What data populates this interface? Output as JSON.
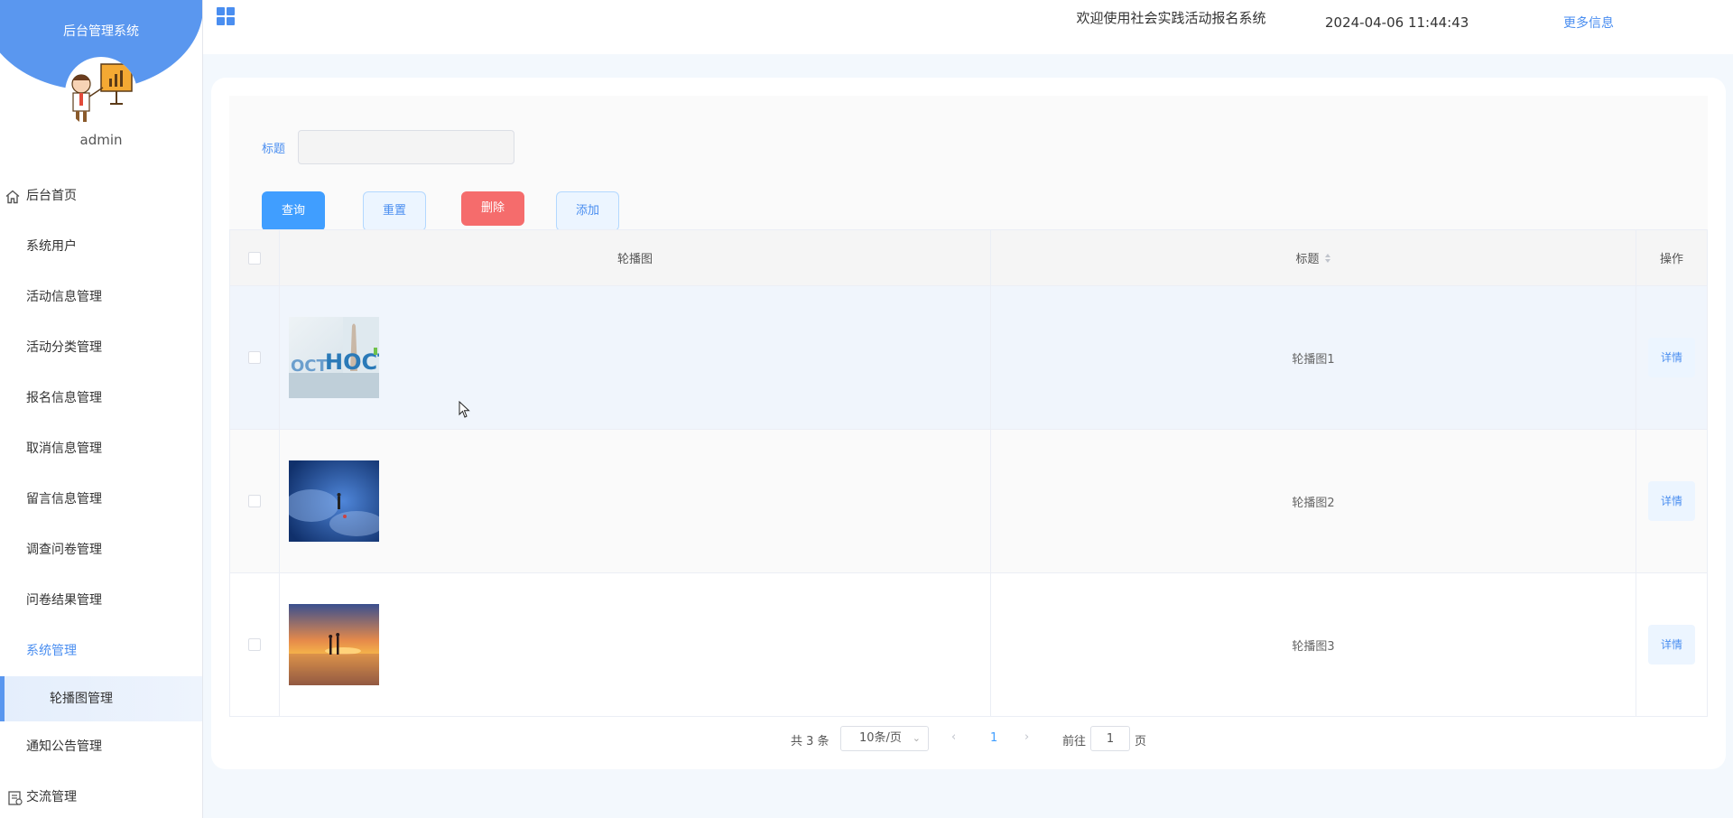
{
  "sidebar": {
    "system_title": "后台管理系统",
    "username": "admin",
    "items": [
      {
        "label": "后台首页",
        "icon": "home-icon"
      },
      {
        "label": "系统用户"
      },
      {
        "label": "活动信息管理"
      },
      {
        "label": "活动分类管理"
      },
      {
        "label": "报名信息管理"
      },
      {
        "label": "取消信息管理"
      },
      {
        "label": "留言信息管理"
      },
      {
        "label": "调查问卷管理"
      },
      {
        "label": "问卷结果管理"
      },
      {
        "label": "系统管理",
        "expanded": true
      },
      {
        "label": "轮播图管理",
        "active": true
      },
      {
        "label": "通知公告管理"
      },
      {
        "label": "交流管理",
        "icon": "document-icon"
      }
    ]
  },
  "header": {
    "menu_icon": "grid-icon",
    "title": "欢迎使用社会实践活动报名系统",
    "datetime": "2024-04-06 11:44:43",
    "more_link": "更多信息"
  },
  "search": {
    "title_label": "标题",
    "title_value": "",
    "query_button": "查询",
    "reset_button": "重置",
    "delete_button": "删除",
    "add_button": "添加"
  },
  "table": {
    "columns": {
      "image": "轮播图",
      "title": "标题",
      "actions": "操作"
    },
    "rows": [
      {
        "title": "轮播图1",
        "detail": "详情"
      },
      {
        "title": "轮播图2",
        "detail": "详情"
      },
      {
        "title": "轮播图3",
        "detail": "详情"
      }
    ]
  },
  "pagination": {
    "total": "共 3 条",
    "page_size": "10条/页",
    "current_page": "1",
    "goto_label": "前往",
    "goto_value": "1",
    "page_unit": "页"
  },
  "colors": {
    "accent": "#409eff",
    "sidebar_header": "#5a97ef",
    "danger": "#f56c6c"
  }
}
